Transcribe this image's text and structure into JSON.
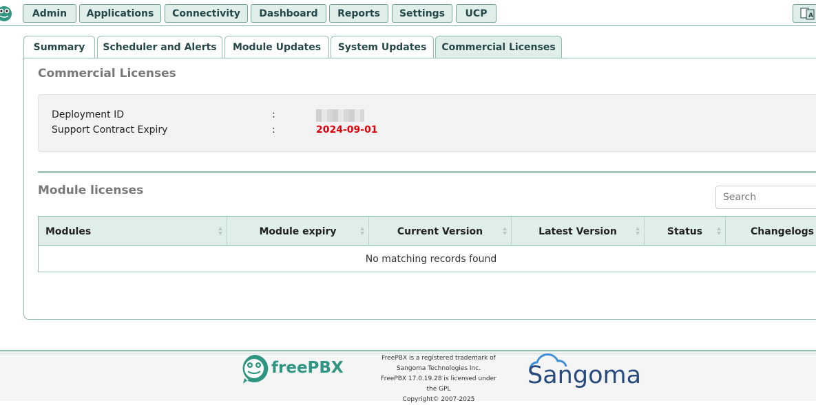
{
  "nav": {
    "items": [
      "Admin",
      "Applications",
      "Connectivity",
      "Dashboard",
      "Reports",
      "Settings",
      "UCP"
    ]
  },
  "tabs": [
    "Summary",
    "Scheduler and Alerts",
    "Module Updates",
    "System Updates",
    "Commercial Licenses"
  ],
  "active_tab": "Commercial Licenses",
  "page": {
    "title": "Commercial Licenses",
    "deployment_label": "Deployment ID",
    "support_label": "Support Contract Expiry",
    "separator": ":",
    "support_expiry": "2024-09-01"
  },
  "modules": {
    "title": "Module licenses",
    "search_placeholder": "Search",
    "columns": [
      "Modules",
      "Module expiry",
      "Current Version",
      "Latest Version",
      "Status",
      "Changelogs"
    ],
    "empty_text": "No matching records found"
  },
  "footer": {
    "brand": "freePBX",
    "legal": [
      "FreePBX is a registered trademark of",
      "Sangoma Technologies Inc.",
      "FreePBX 17.0.19.28 is licensed under",
      "the GPL",
      "Copyright© 2007-2025"
    ],
    "partner": "Sangoma"
  },
  "colors": {
    "accent": "#2e9683",
    "nav_bg": "#dfeee8",
    "expiry": "#e0000a"
  }
}
